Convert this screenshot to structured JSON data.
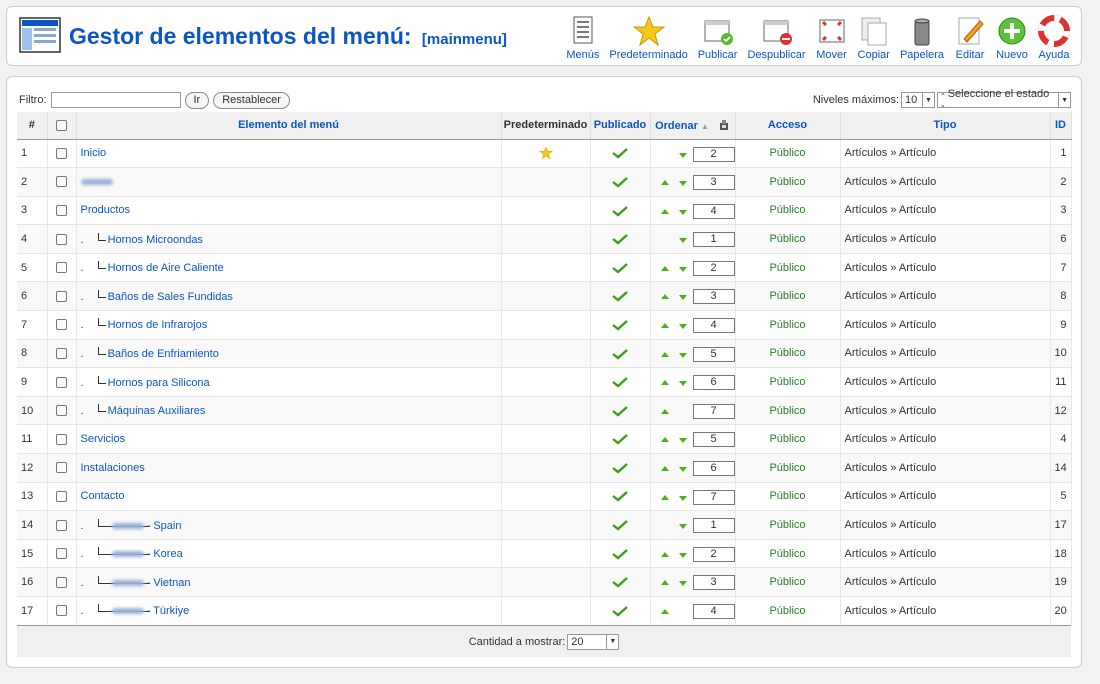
{
  "header": {
    "title": "Gestor de elementos del menú:",
    "subtitle": "[mainmenu]"
  },
  "toolbar": [
    {
      "label": "Menús",
      "icon": "menus-icon"
    },
    {
      "label": "Predeterminado",
      "icon": "star-icon"
    },
    {
      "label": "Publicar",
      "icon": "publish-icon"
    },
    {
      "label": "Despublicar",
      "icon": "unpublish-icon"
    },
    {
      "label": "Mover",
      "icon": "move-icon"
    },
    {
      "label": "Copiar",
      "icon": "copy-icon"
    },
    {
      "label": "Papelera",
      "icon": "trash-icon"
    },
    {
      "label": "Editar",
      "icon": "edit-icon"
    },
    {
      "label": "Nuevo",
      "icon": "new-icon"
    },
    {
      "label": "Ayuda",
      "icon": "help-icon"
    }
  ],
  "filter": {
    "label": "Filtro:",
    "value": "",
    "go_label": "Ir",
    "reset_label": "Restablecer"
  },
  "levels": {
    "label": "Niveles máximos:",
    "value": "10",
    "state_value": "- Seleccione el estado -"
  },
  "columns": {
    "num": "#",
    "name": "Elemento del menú",
    "default": "Predeterminado",
    "published": "Publicado",
    "order": "Ordenar",
    "access": "Acceso",
    "type": "Tipo",
    "id": "ID"
  },
  "rows": [
    {
      "num": "1",
      "name": "Inicio",
      "level": 0,
      "blur": false,
      "is_default": true,
      "up": false,
      "down": true,
      "order": "2",
      "access": "Público",
      "type": "Artículos » Artículo",
      "id": "1"
    },
    {
      "num": "2",
      "name": "",
      "level": 0,
      "blur": true,
      "is_default": false,
      "up": true,
      "down": true,
      "order": "3",
      "access": "Público",
      "type": "Artículos » Artículo",
      "id": "2"
    },
    {
      "num": "3",
      "name": "Productos",
      "level": 0,
      "blur": false,
      "is_default": false,
      "up": true,
      "down": true,
      "order": "4",
      "access": "Público",
      "type": "Artículos » Artículo",
      "id": "3"
    },
    {
      "num": "4",
      "name": "Hornos Microondas",
      "level": 1,
      "blur": false,
      "is_default": false,
      "up": false,
      "down": true,
      "order": "1",
      "access": "Público",
      "type": "Artículos » Artículo",
      "id": "6"
    },
    {
      "num": "5",
      "name": "Hornos de Aire Caliente",
      "level": 1,
      "blur": false,
      "is_default": false,
      "up": true,
      "down": true,
      "order": "2",
      "access": "Público",
      "type": "Artículos » Artículo",
      "id": "7"
    },
    {
      "num": "6",
      "name": "Baños de Sales Fundidas",
      "level": 1,
      "blur": false,
      "is_default": false,
      "up": true,
      "down": true,
      "order": "3",
      "access": "Público",
      "type": "Artículos » Artículo",
      "id": "8"
    },
    {
      "num": "7",
      "name": "Hornos de Infrarojos",
      "level": 1,
      "blur": false,
      "is_default": false,
      "up": true,
      "down": true,
      "order": "4",
      "access": "Público",
      "type": "Artículos » Artículo",
      "id": "9"
    },
    {
      "num": "8",
      "name": "Baños de Enfriamiento",
      "level": 1,
      "blur": false,
      "is_default": false,
      "up": true,
      "down": true,
      "order": "5",
      "access": "Público",
      "type": "Artículos » Artículo",
      "id": "10"
    },
    {
      "num": "9",
      "name": "Hornos para Silicona",
      "level": 1,
      "blur": false,
      "is_default": false,
      "up": true,
      "down": true,
      "order": "6",
      "access": "Público",
      "type": "Artículos » Artículo",
      "id": "11"
    },
    {
      "num": "10",
      "name": "Máquinas Auxiliares",
      "level": 1,
      "blur": false,
      "is_default": false,
      "up": true,
      "down": false,
      "order": "7",
      "access": "Público",
      "type": "Artículos » Artículo",
      "id": "12"
    },
    {
      "num": "11",
      "name": "Servicios",
      "level": 0,
      "blur": false,
      "is_default": false,
      "up": true,
      "down": true,
      "order": "5",
      "access": "Público",
      "type": "Artículos » Artículo",
      "id": "4"
    },
    {
      "num": "12",
      "name": "Instalaciones",
      "level": 0,
      "blur": false,
      "is_default": false,
      "up": true,
      "down": true,
      "order": "6",
      "access": "Público",
      "type": "Artículos » Artículo",
      "id": "14"
    },
    {
      "num": "13",
      "name": "Contacto",
      "level": 0,
      "blur": false,
      "is_default": false,
      "up": true,
      "down": true,
      "order": "7",
      "access": "Público",
      "type": "Artículos » Artículo",
      "id": "5"
    },
    {
      "num": "14",
      "name": "- Spain",
      "level": 2,
      "blur": true,
      "is_default": false,
      "up": false,
      "down": true,
      "order": "1",
      "access": "Público",
      "type": "Artículos » Artículo",
      "id": "17"
    },
    {
      "num": "15",
      "name": "- Korea",
      "level": 2,
      "blur": true,
      "is_default": false,
      "up": true,
      "down": true,
      "order": "2",
      "access": "Público",
      "type": "Artículos » Artículo",
      "id": "18"
    },
    {
      "num": "16",
      "name": "- Vietnan",
      "level": 2,
      "blur": true,
      "is_default": false,
      "up": true,
      "down": true,
      "order": "3",
      "access": "Público",
      "type": "Artículos » Artículo",
      "id": "19"
    },
    {
      "num": "17",
      "name": "- Türkiye",
      "level": 2,
      "blur": true,
      "is_default": false,
      "up": true,
      "down": false,
      "order": "4",
      "access": "Público",
      "type": "Artículos » Artículo",
      "id": "20"
    }
  ],
  "footer": {
    "label": "Cantidad a mostrar:",
    "value": "20"
  }
}
